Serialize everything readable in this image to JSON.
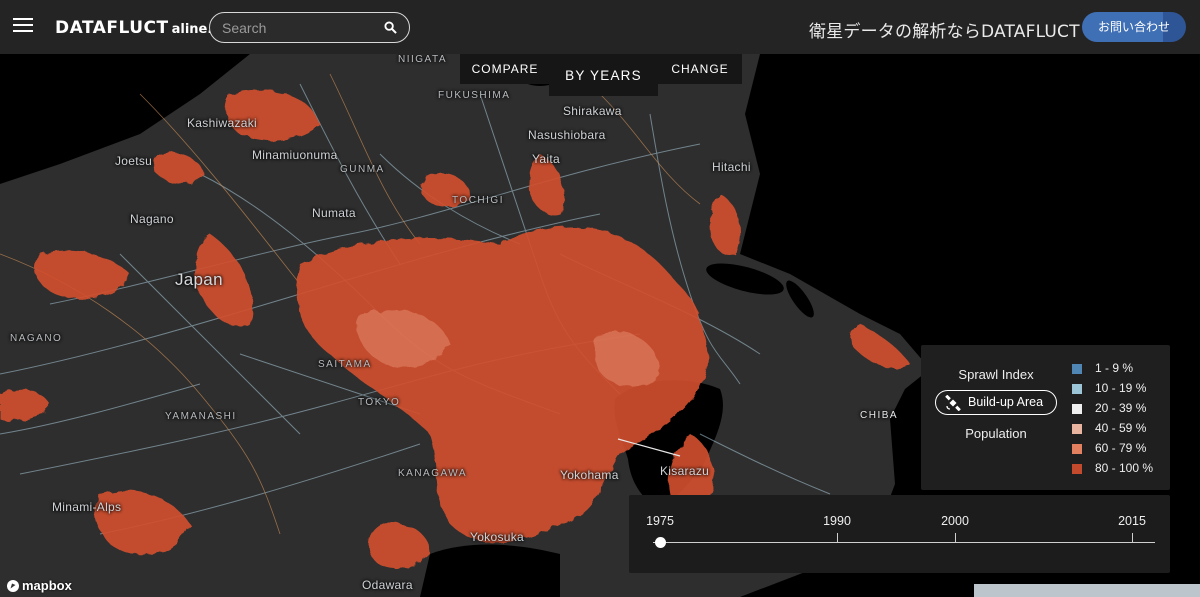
{
  "header": {
    "menu_icon": "hamburger-menu-icon",
    "logo_main": "DATAFLUCT",
    "logo_sub": "aline.",
    "search_placeholder": "Search",
    "search_icon": "search-icon",
    "tagline": "衛星データの解析ならDATAFLUCT",
    "contact_label": "お問い合わせ"
  },
  "mode_tabs": [
    {
      "label": "COMPARE",
      "active": false
    },
    {
      "label": "BY YEARS",
      "active": true
    },
    {
      "label": "CHANGE",
      "active": false
    }
  ],
  "map": {
    "places": [
      {
        "id": "niigata",
        "text": "NIIGATA",
        "type": "pref"
      },
      {
        "id": "fukushima",
        "text": "FUKUSHIMA",
        "type": "pref"
      },
      {
        "id": "kashiwazaki",
        "text": "Kashiwazaki",
        "type": "city"
      },
      {
        "id": "shirakawa",
        "text": "Shirakawa",
        "type": "city"
      },
      {
        "id": "nasushiobara",
        "text": "Nasushiobara",
        "type": "city"
      },
      {
        "id": "joetsu",
        "text": "Joetsu",
        "type": "city"
      },
      {
        "id": "minamiuonuma",
        "text": "Minamiuonuma",
        "type": "city"
      },
      {
        "id": "yaita",
        "text": "Yaita",
        "type": "city"
      },
      {
        "id": "hitachi",
        "text": "Hitachi",
        "type": "city"
      },
      {
        "id": "gunma",
        "text": "GUNMA",
        "type": "pref"
      },
      {
        "id": "tochigi",
        "text": "TOCHIGI",
        "type": "pref"
      },
      {
        "id": "numata",
        "text": "Numata",
        "type": "city"
      },
      {
        "id": "nagano-city",
        "text": "Nagano",
        "type": "city"
      },
      {
        "id": "japan",
        "text": "Japan",
        "type": "big"
      },
      {
        "id": "nagano-pref",
        "text": "NAGANO",
        "type": "pref"
      },
      {
        "id": "saitama",
        "text": "SAITAMA",
        "type": "pref"
      },
      {
        "id": "tokyo",
        "text": "TOKYO",
        "type": "pref"
      },
      {
        "id": "yamanashi",
        "text": "YAMANASHI",
        "type": "pref"
      },
      {
        "id": "chiba",
        "text": "CHIBA",
        "type": "pref"
      },
      {
        "id": "kanagawa",
        "text": "KANAGAWA",
        "type": "pref"
      },
      {
        "id": "yokohama",
        "text": "Yokohama",
        "type": "city"
      },
      {
        "id": "kisarazu",
        "text": "Kisarazu",
        "type": "city"
      },
      {
        "id": "minami-alps",
        "text": "Minami-Alps",
        "type": "city"
      },
      {
        "id": "odawara",
        "text": "Odawara",
        "type": "city"
      },
      {
        "id": "yokosuka",
        "text": "Yokosuka",
        "type": "city"
      }
    ]
  },
  "legend": {
    "layers": [
      {
        "label": "Sprawl Index",
        "active": false
      },
      {
        "label": "Build-up Area",
        "active": true,
        "icon": "satellite-icon"
      },
      {
        "label": "Population",
        "active": false
      }
    ],
    "items": [
      {
        "label": "1 - 9 %",
        "color": "#4f86b3"
      },
      {
        "label": "10 - 19 %",
        "color": "#9cc6d8"
      },
      {
        "label": "20 - 39 %",
        "color": "#efefef"
      },
      {
        "label": "40 - 59 %",
        "color": "#e9b49f"
      },
      {
        "label": "60 - 79 %",
        "color": "#e3805f"
      },
      {
        "label": "80 - 100 %",
        "color": "#c44a2d"
      }
    ]
  },
  "timeline": {
    "labels": [
      "1975",
      "1990",
      "2000",
      "2015"
    ],
    "selected_year": 1975,
    "min_year": 1975,
    "max_year": 2018
  },
  "mapbox_label": "mapbox"
}
